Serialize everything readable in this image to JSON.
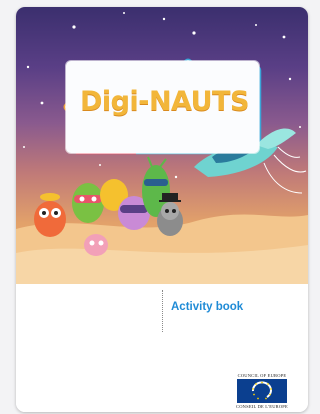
{
  "cover": {
    "title": "Digi-NAUTS",
    "subtitle": "Activity book"
  },
  "publisher": {
    "name_top": "COUNCIL OF EUROPE",
    "name_bottom": "CONSEIL DE L'EUROPE",
    "flag_color": "#0b3f8f"
  },
  "colors": {
    "sky_top": "#3b2f6e",
    "sky_bottom": "#efb978",
    "title_gold": "#f2b63a",
    "subtitle_blue": "#1f8bd6"
  }
}
